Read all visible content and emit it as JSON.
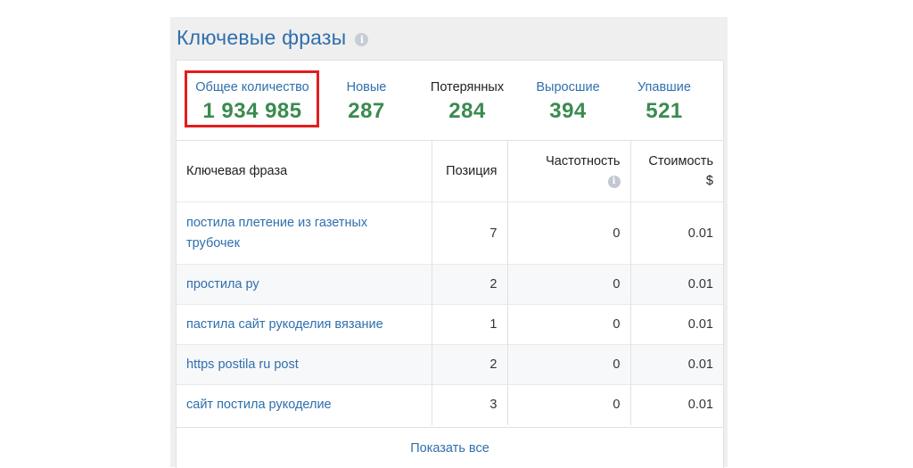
{
  "widget": {
    "title": "Ключевые фразы",
    "info_icon": "info-circle-icon"
  },
  "stats": [
    {
      "label": "Общее количество",
      "value": "1 934 985"
    },
    {
      "label": "Новые",
      "value": "287"
    },
    {
      "label": "Потерянных",
      "value": "284"
    },
    {
      "label": "Выросшие",
      "value": "394"
    },
    {
      "label": "Упавшие",
      "value": "521"
    }
  ],
  "table": {
    "headers": {
      "keyword": "Ключевая фраза",
      "position": "Позиция",
      "frequency": "Частотность",
      "cost_line1": "Стоимость",
      "cost_line2": "$"
    },
    "rows": [
      {
        "keyword": "постила плетение из газетных трубочек",
        "position": "7",
        "frequency": "0",
        "cost": "0.01"
      },
      {
        "keyword": "простила ру",
        "position": "2",
        "frequency": "0",
        "cost": "0.01"
      },
      {
        "keyword": "пастила сайт рукоделия вязание",
        "position": "1",
        "frequency": "0",
        "cost": "0.01"
      },
      {
        "keyword": "https postila ru post",
        "position": "2",
        "frequency": "0",
        "cost": "0.01"
      },
      {
        "keyword": "сайт постила рукоделие",
        "position": "3",
        "frequency": "0",
        "cost": "0.01"
      }
    ]
  },
  "show_all_label": "Показать все",
  "colors": {
    "accent_blue": "#2f6fad",
    "value_green": "#3a8b4f",
    "highlight_red": "#e31d1d"
  }
}
